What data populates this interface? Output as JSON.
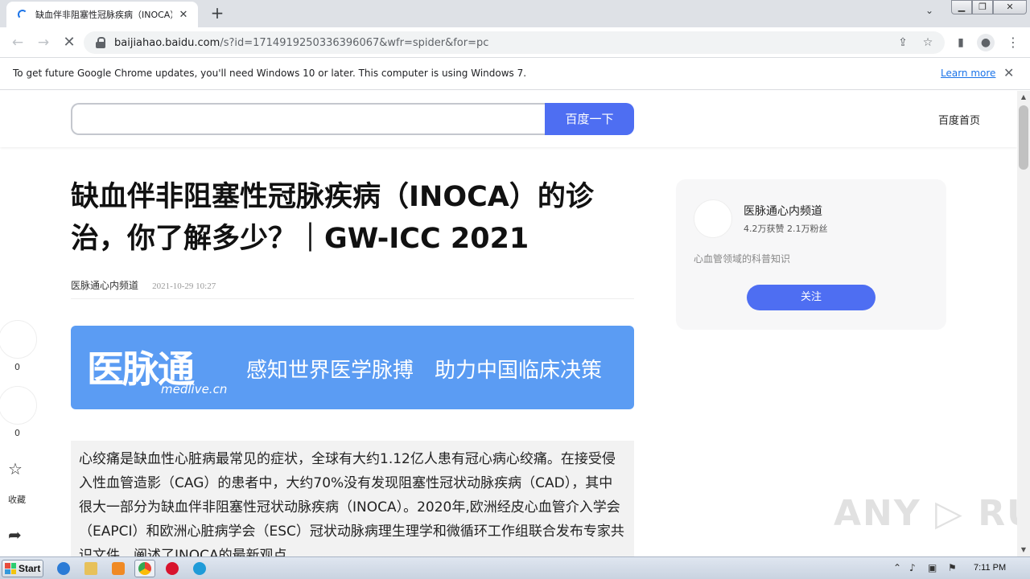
{
  "browser": {
    "tab_title": "缺血伴非阻塞性冠脉疾病（INOCA）",
    "tab_close": "✕",
    "new_tab": "+",
    "url_host": "baijiahao.baidu.com",
    "url_path": "/s?id=1714919250336396067&wfr=spider&for=pc"
  },
  "infobar": {
    "message": "To get future Google Chrome updates, you'll need Windows 10 or later. This computer is using Windows 7.",
    "link": "Learn more",
    "close": "✕"
  },
  "page": {
    "search_button": "百度一下",
    "home_link": "百度首页",
    "article_title": "缺血伴非阻塞性冠脉疾病（INOCA）的诊治，你了解多少？｜GW-ICC 2021",
    "author": "医脉通心内频道",
    "date": "2021-10-29 10:27",
    "banner_logo": "医脉通",
    "banner_logo_sub": "medlive.cn",
    "banner_slogan": "感知世界医学脉搏　助力中国临床决策",
    "paragraph": "心绞痛是缺血性心脏病最常见的症状，全球有大约1.12亿人患有冠心病心绞痛。在接受侵入性血管造影（CAG）的患者中，大约70%没有发现阻塞性冠状动脉疾病（CAD），其中很大一部分为缺血伴非阻塞性冠状动脉疾病（INOCA）。2020年,欧洲经皮心血管介入学会（EAPCI）和欧洲心脏病学会（ESC）冠状动脉病理生理学和微循环工作组联合发布专家共识文件，阐述了INOCA的最新观点。"
  },
  "rail": {
    "like_count": "0",
    "comment_count": "0",
    "collect_label": "收藏"
  },
  "author_card": {
    "name": "医脉通心内频道",
    "stats": "4.2万获赞 2.1万粉丝",
    "desc": "心血管领域的科普知识",
    "follow": "关注"
  },
  "watermark": "ANY ▷ RUN",
  "taskbar": {
    "start": "Start",
    "clock": "7:11 PM"
  },
  "colors": {
    "accent": "#4e6ef2",
    "chrome_link": "#1a73e8",
    "banner": "#5b9cf3"
  }
}
